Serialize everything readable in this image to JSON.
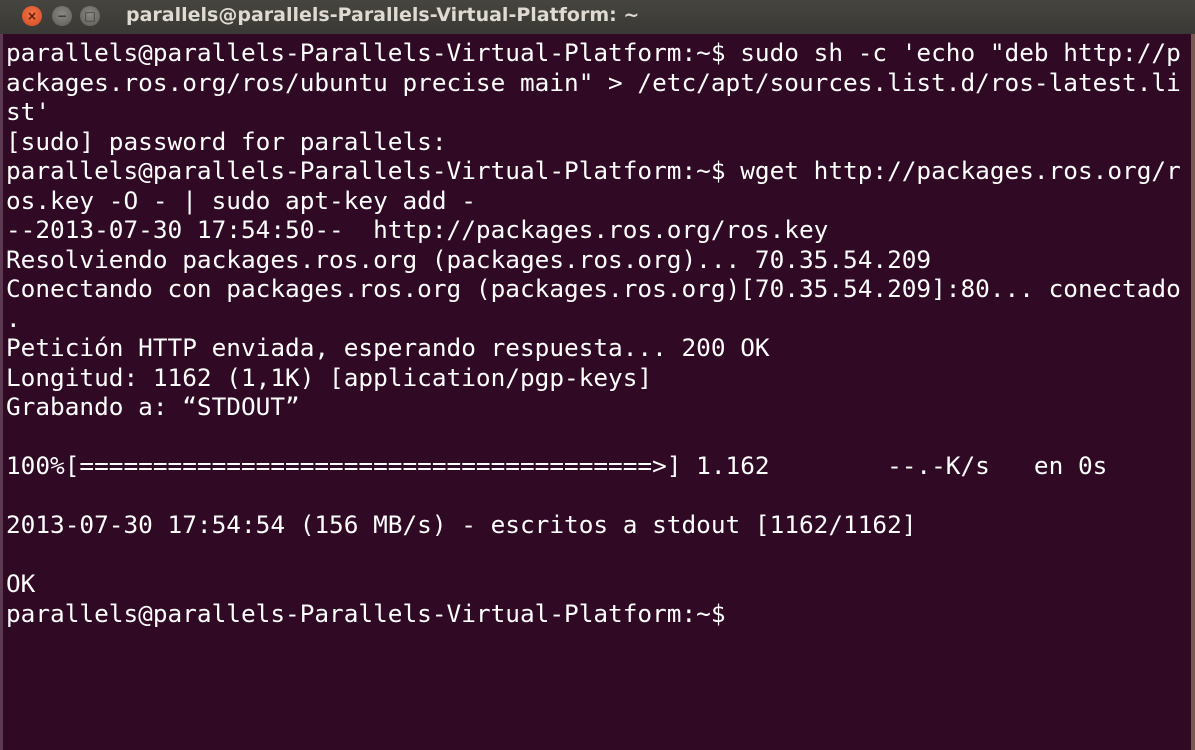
{
  "window": {
    "title": "parallels@parallels-Parallels-Virtual-Platform: ~",
    "close_glyph": "×",
    "minimize_glyph": "−",
    "maximize_glyph": "□"
  },
  "terminal": {
    "lines": [
      "parallels@parallels-Parallels-Virtual-Platform:~$ sudo sh -c 'echo \"deb http://p",
      "ackages.ros.org/ros/ubuntu precise main\" > /etc/apt/sources.list.d/ros-latest.li",
      "st'",
      "[sudo] password for parallels:",
      "parallels@parallels-Parallels-Virtual-Platform:~$ wget http://packages.ros.org/r",
      "os.key -O - | sudo apt-key add -",
      "--2013-07-30 17:54:50--  http://packages.ros.org/ros.key",
      "Resolviendo packages.ros.org (packages.ros.org)... 70.35.54.209",
      "Conectando con packages.ros.org (packages.ros.org)[70.35.54.209]:80... conectado",
      ".",
      "Petición HTTP enviada, esperando respuesta... 200 OK",
      "Longitud: 1162 (1,1K) [application/pgp-keys]",
      "Grabando a: “STDOUT”",
      "",
      "100%[=======================================>] 1.162        --.-K/s   en 0s",
      "",
      "2013-07-30 17:54:54 (156 MB/s) - escritos a stdout [1162/1162]",
      "",
      "OK",
      "parallels@parallels-Parallels-Virtual-Platform:~$ "
    ]
  }
}
